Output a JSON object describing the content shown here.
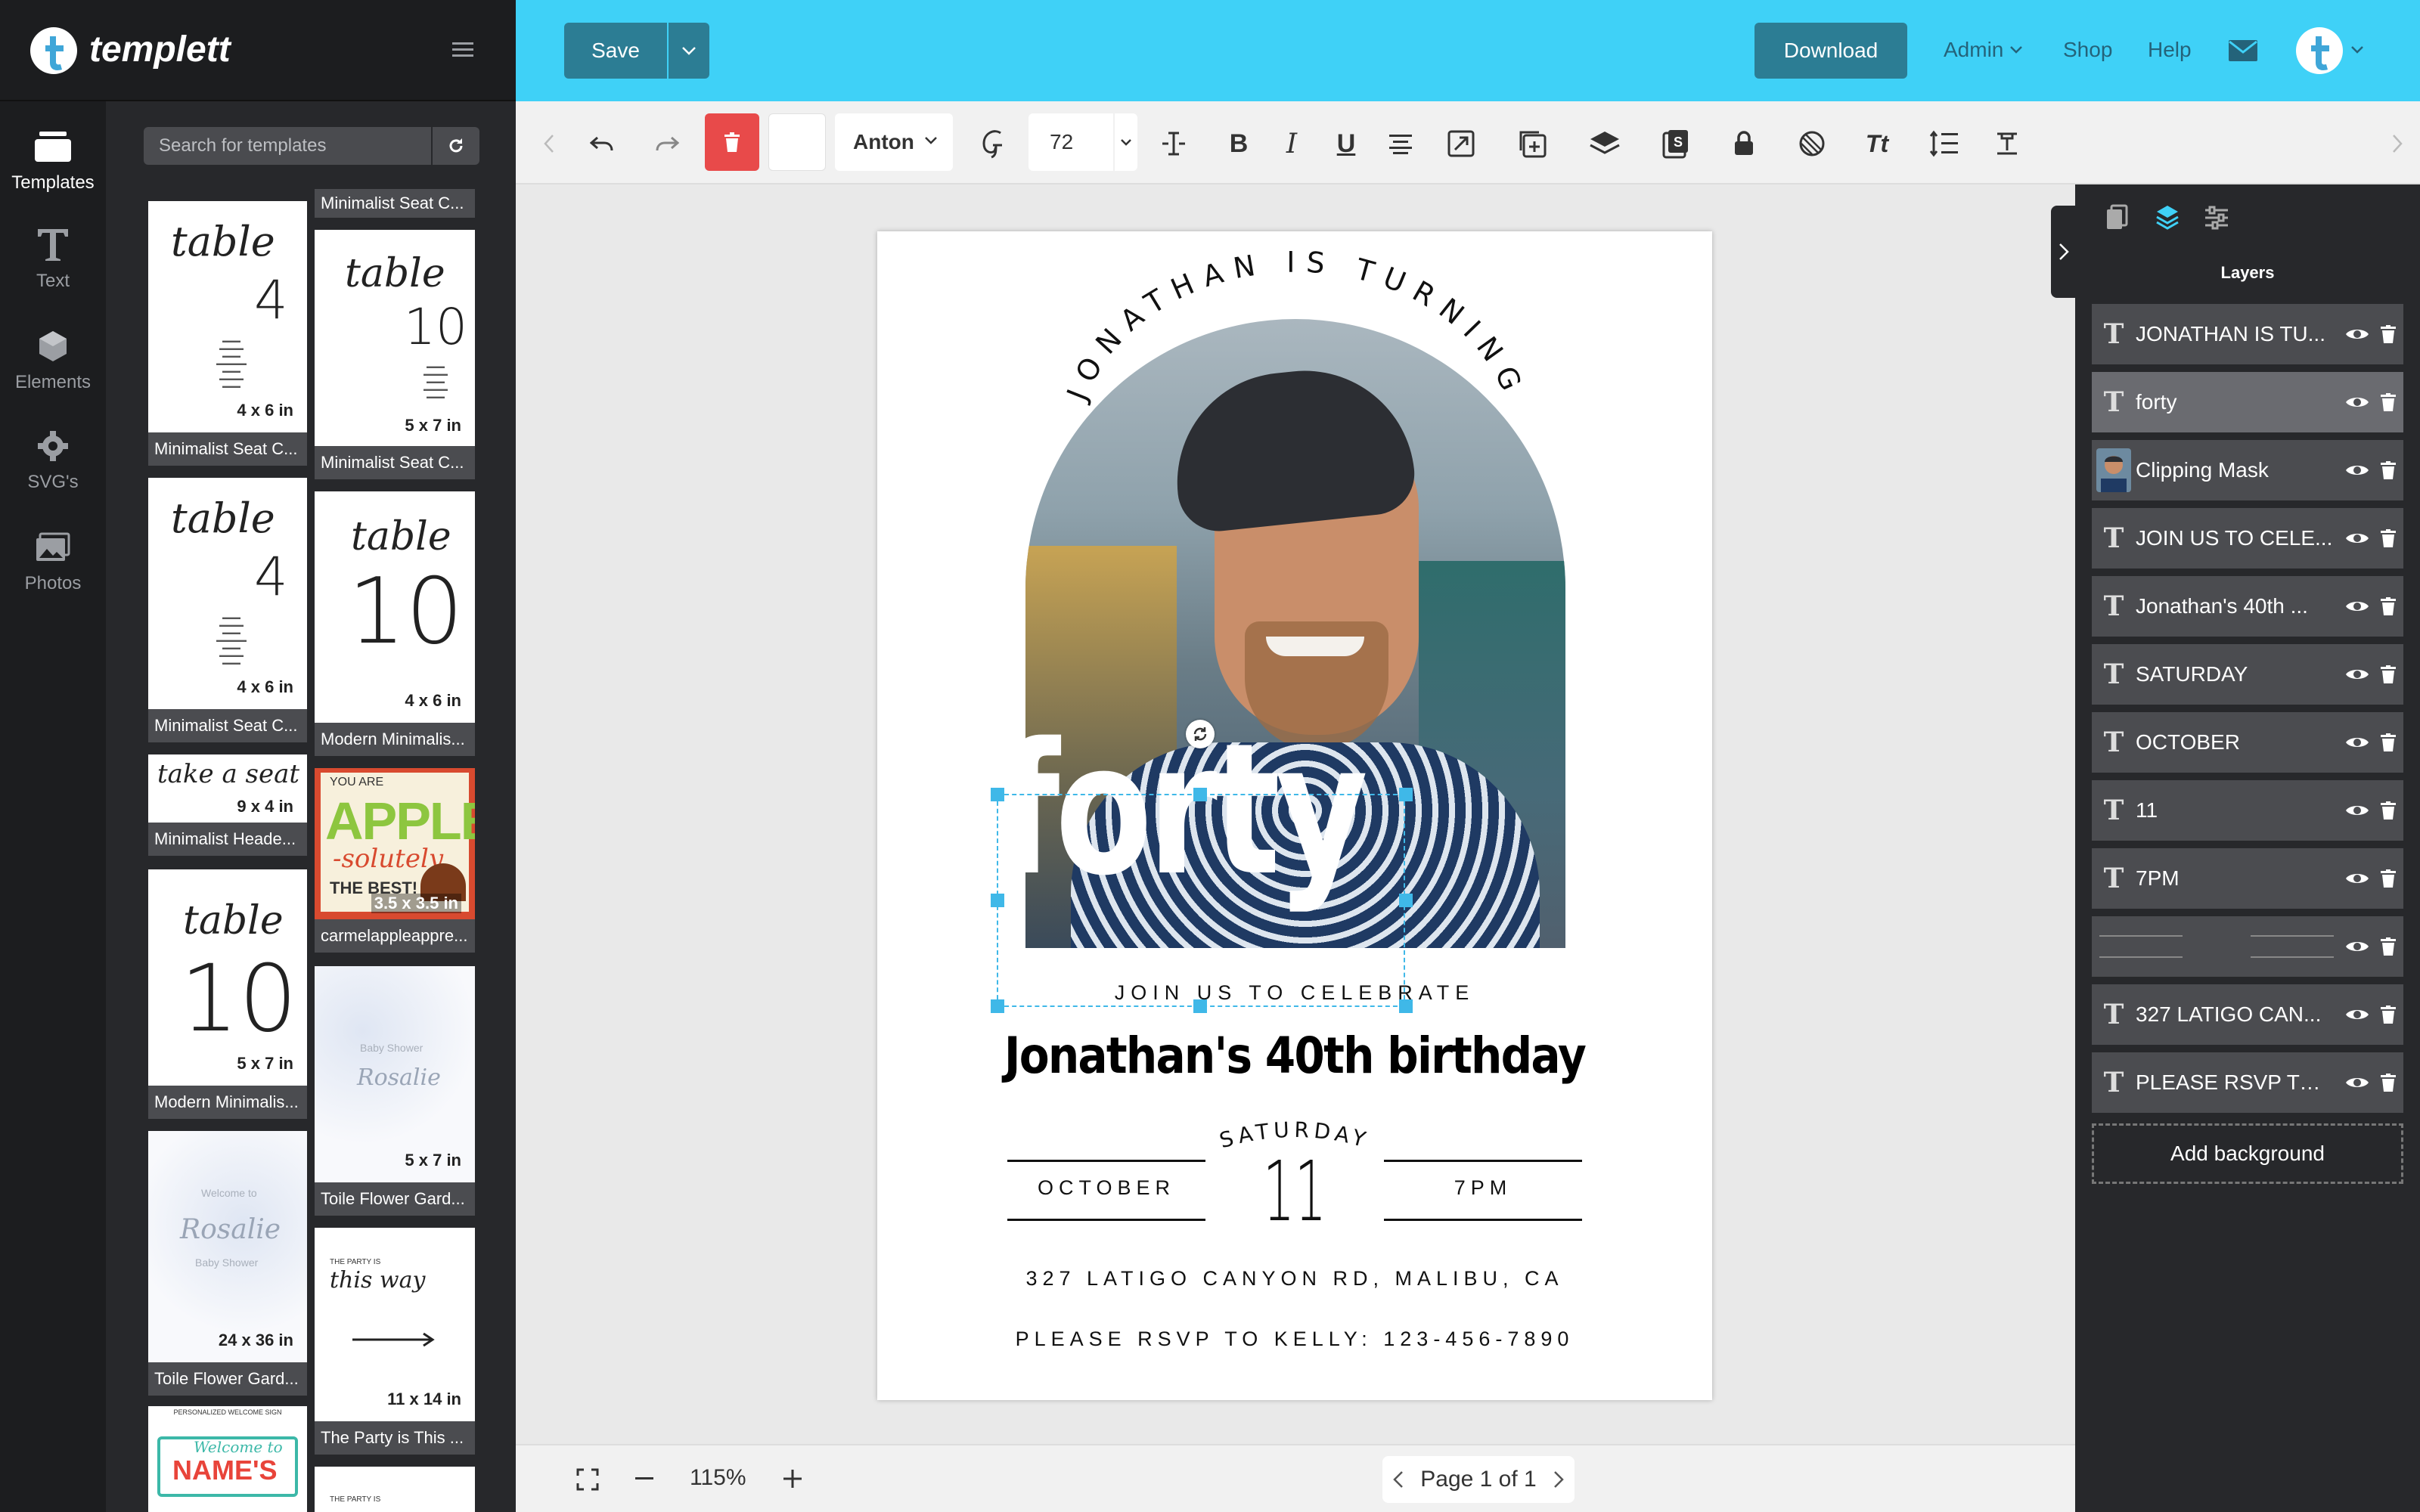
{
  "app": {
    "name": "templett"
  },
  "rail": [
    {
      "label": "Templates",
      "icon": "templates-icon"
    },
    {
      "label": "Text",
      "icon": "text-icon"
    },
    {
      "label": "Elements",
      "icon": "elements-icon"
    },
    {
      "label": "SVG's",
      "icon": "svg-icon"
    },
    {
      "label": "Photos",
      "icon": "photos-icon"
    }
  ],
  "search": {
    "placeholder": "Search for templates"
  },
  "templates": {
    "top_caption": "Minimalist Seat C...",
    "cards": [
      {
        "caption": "Minimalist Seat C...",
        "size": "4 x 6 in",
        "script": "table",
        "number": "4"
      },
      {
        "caption": "Minimalist Seat C...",
        "size": "5 x 7 in",
        "script": "table",
        "number": "10"
      },
      {
        "caption": "Minimalist Seat C...",
        "size": "4 x 6 in",
        "script": "table",
        "number": "4"
      },
      {
        "caption": "Modern Minimalis...",
        "size": "4 x 6 in",
        "script": "table",
        "number": "10"
      },
      {
        "caption": "Minimalist Heade...",
        "size": "9 x 4 in",
        "script": "take a seat"
      },
      {
        "caption": "carmelappleappre...",
        "size": "3.5 x 3.5 in",
        "headline": "APPLE",
        "top": "YOU ARE",
        "mid": "-solutely",
        "bottom": "THE BEST!"
      },
      {
        "caption": "Modern Minimalis...",
        "size": "5 x 7 in",
        "script": "table",
        "number": "10"
      },
      {
        "caption": "Toile Flower Gard...",
        "size": "5 x 7 in",
        "script": "Rosalie",
        "sub": "Baby Shower"
      },
      {
        "caption": "Toile Flower Gard...",
        "size": "24 x 36 in",
        "script": "Rosalie",
        "sub": "Baby Shower",
        "top": "Welcome to"
      },
      {
        "caption": "The Party is This ...",
        "size": "11 x 14 in",
        "top": "THE PARTY IS",
        "script": "this way"
      },
      {
        "headline": "NAME'S",
        "script": "Welcome to",
        "top": "PERSONALIZED WELCOME SIGN"
      },
      {
        "top": "THE PARTY IS"
      }
    ]
  },
  "topbar": {
    "save": "Save",
    "download": "Download",
    "links": [
      "Admin",
      "Shop",
      "Help"
    ],
    "accent": "#3fd1f7"
  },
  "toolbar": {
    "font": "Anton",
    "font_size": "72",
    "delete_color": "#e84a4a"
  },
  "design": {
    "arc_text": "JONATHAN IS TURNING",
    "big_word": "forty",
    "join": "JOIN US TO CELEBRATE",
    "title": "Jonathan's 40th birthday",
    "day": "SATURDAY",
    "month": "OCTOBER",
    "date": "11",
    "time": "7PM",
    "address": "327 LATIGO CANYON RD, MALIBU, CA",
    "rsvp": "PLEASE RSVP TO KELLY: 123-456-7890"
  },
  "bottombar": {
    "zoom": "115%",
    "page": "Page 1 of 1"
  },
  "right_panel": {
    "title": "Layers",
    "layers": [
      {
        "name": "JONATHAN IS TU...",
        "type": "text"
      },
      {
        "name": "forty",
        "type": "text",
        "active": true
      },
      {
        "name": "Clipping Mask",
        "type": "image"
      },
      {
        "name": "JOIN US TO CELE...",
        "type": "text"
      },
      {
        "name": "Jonathan's 40th ...",
        "type": "text"
      },
      {
        "name": "SATURDAY",
        "type": "text"
      },
      {
        "name": "OCTOBER",
        "type": "text"
      },
      {
        "name": "11",
        "type": "text"
      },
      {
        "name": "7PM",
        "type": "text"
      },
      {
        "name": "",
        "type": "lines"
      },
      {
        "name": "327 LATIGO CAN...",
        "type": "text"
      },
      {
        "name": "PLEASE RSVP TO ...",
        "type": "text"
      }
    ],
    "add_background": "Add background"
  }
}
